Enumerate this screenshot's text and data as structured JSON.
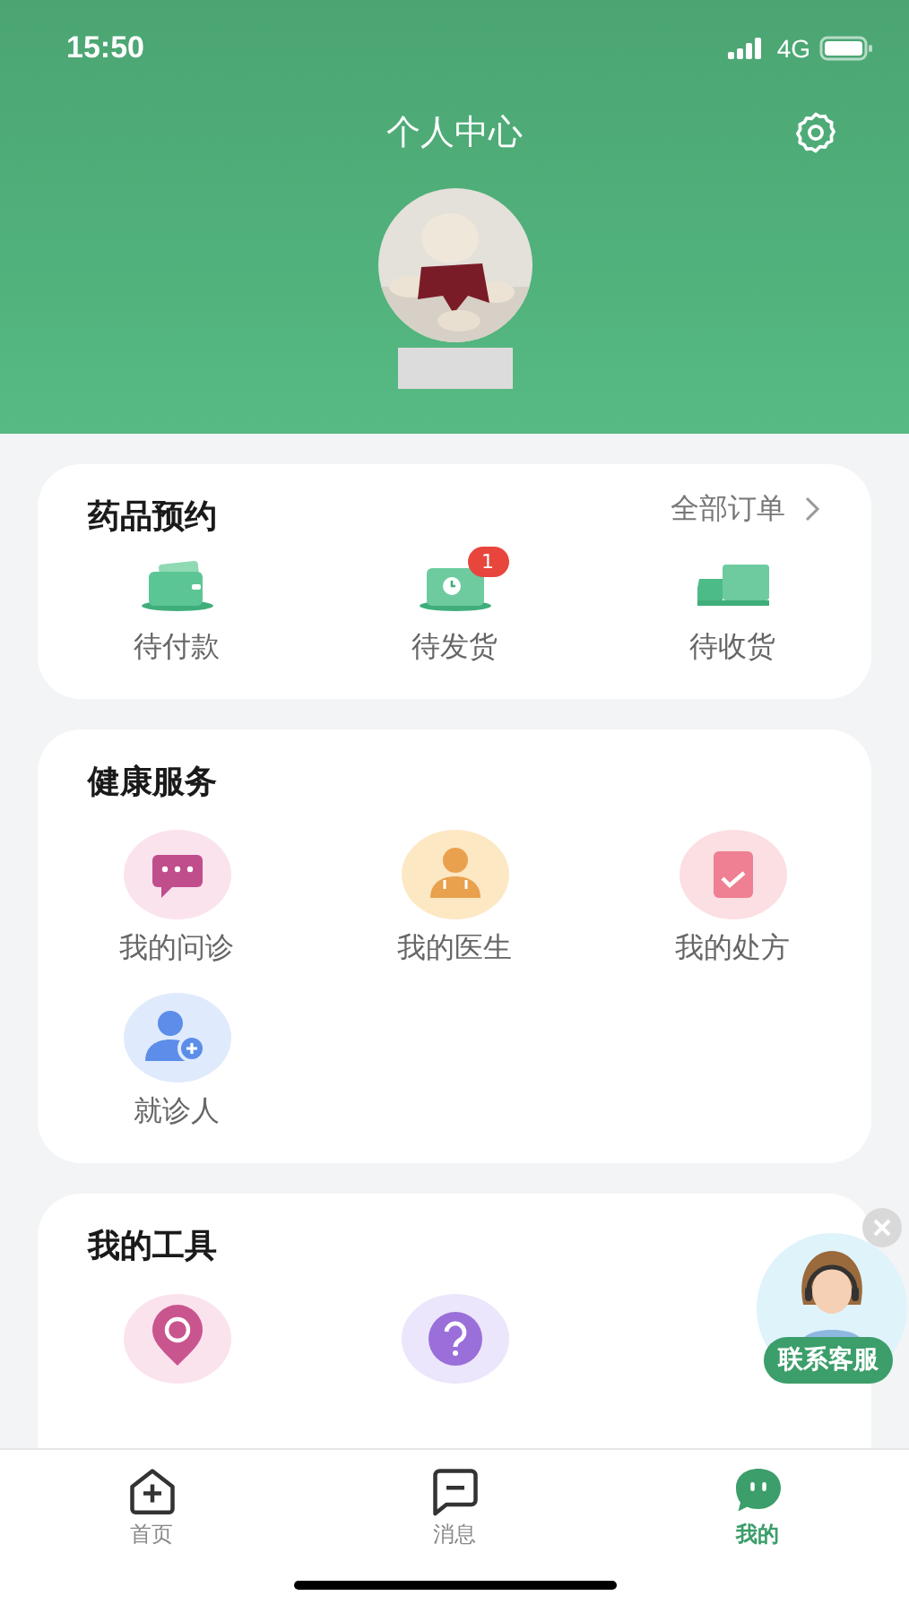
{
  "status_bar": {
    "time": "15:50",
    "network": "4G"
  },
  "header": {
    "title": "个人中心"
  },
  "orders": {
    "title": "药品预约",
    "link": "全部订单",
    "items": [
      {
        "label": "待付款",
        "kind": "wallet"
      },
      {
        "label": "待发货",
        "kind": "clock",
        "badge": "1"
      },
      {
        "label": "待收货",
        "kind": "truck"
      }
    ]
  },
  "health_services": {
    "title": "健康服务",
    "items": [
      {
        "label": "我的问诊",
        "kind": "chat"
      },
      {
        "label": "我的医生",
        "kind": "doctor"
      },
      {
        "label": "我的处方",
        "kind": "prescription"
      },
      {
        "label": "就诊人",
        "kind": "patient"
      }
    ]
  },
  "tools": {
    "title": "我的工具",
    "items": [
      {
        "kind": "location"
      },
      {
        "kind": "help"
      }
    ]
  },
  "customer_service": {
    "label": "联系客服"
  },
  "tab_bar": [
    {
      "label": "首页",
      "kind": "home",
      "selected": false
    },
    {
      "label": "消息",
      "kind": "message",
      "selected": false
    },
    {
      "label": "我的",
      "kind": "mine",
      "selected": true
    }
  ]
}
